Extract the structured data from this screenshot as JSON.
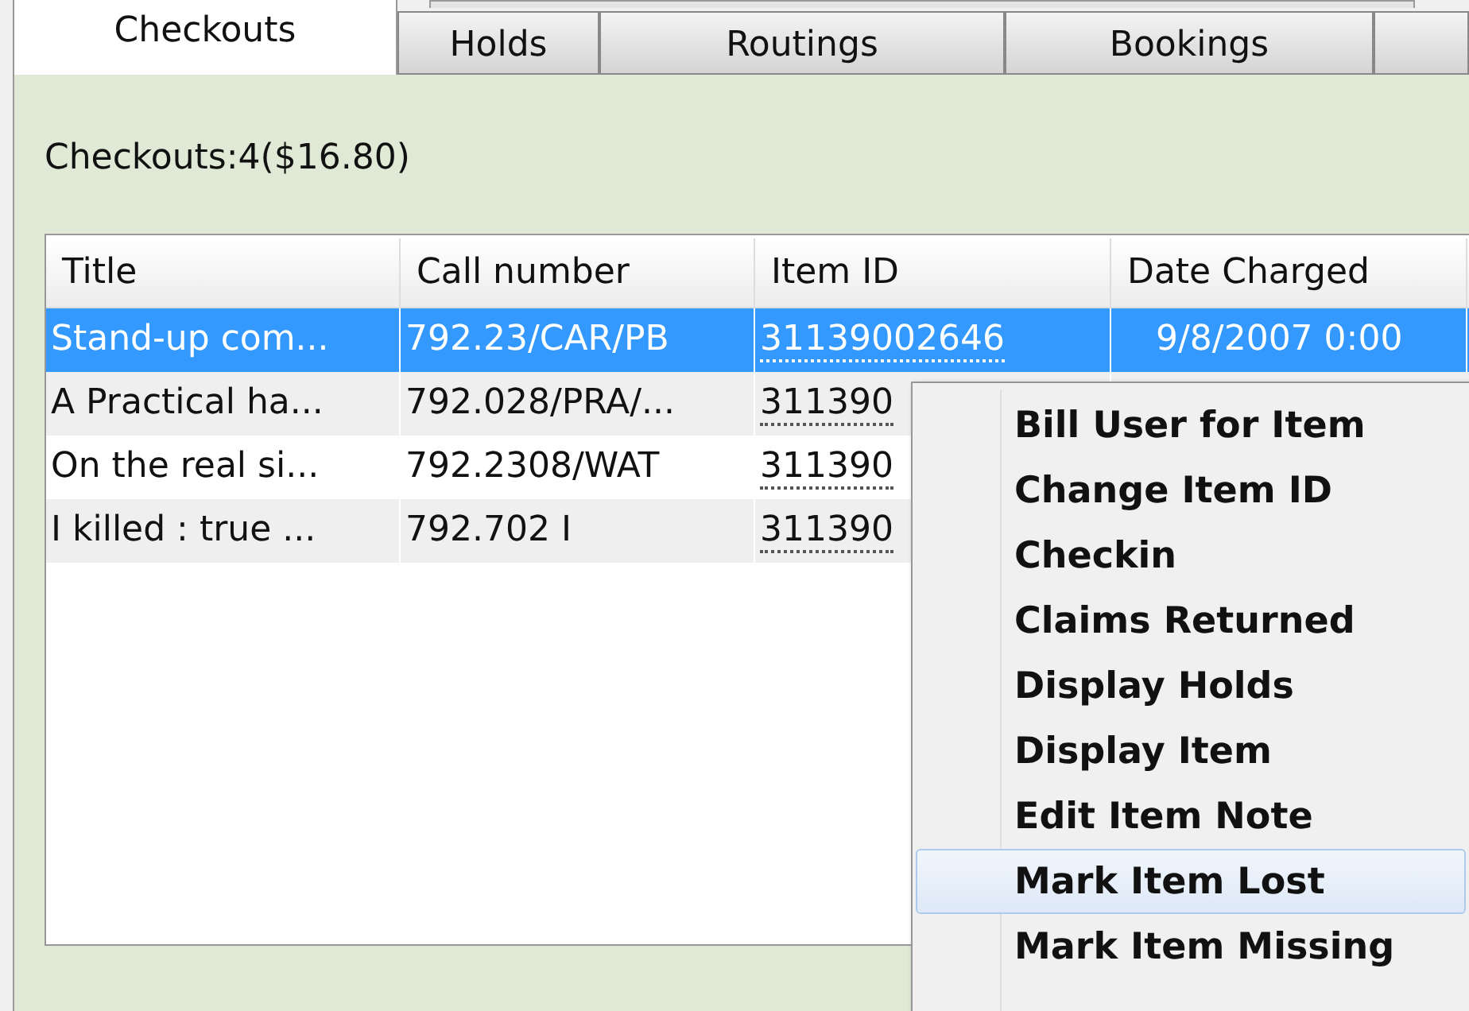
{
  "tabs": [
    {
      "label": "Checkouts",
      "selected": true
    },
    {
      "label": "Holds",
      "selected": false
    },
    {
      "label": "Routings",
      "selected": false
    },
    {
      "label": "Bookings",
      "selected": false
    }
  ],
  "summary": "Checkouts:4($16.80)",
  "table": {
    "columns": [
      "Title",
      "Call number",
      "Item ID",
      "Date Charged"
    ],
    "rows": [
      {
        "selected": true,
        "cells": [
          "Stand-up com...",
          "792.23/CAR/PB",
          "31139002646",
          "9/8/2007 0:00"
        ]
      },
      {
        "selected": false,
        "cells": [
          "A Practical ha...",
          "792.028/PRA/...",
          "311390"
        ]
      },
      {
        "selected": false,
        "cells": [
          "On the real si...",
          "792.2308/WAT",
          "311390"
        ]
      },
      {
        "selected": false,
        "cells": [
          "I killed : true ...",
          "792.702 I",
          "311390"
        ]
      }
    ]
  },
  "context_menu": {
    "items": [
      {
        "label": "Bill User for Item",
        "selected": false
      },
      {
        "label": "Change Item ID",
        "selected": false
      },
      {
        "label": "Checkin",
        "selected": false
      },
      {
        "label": "Claims Returned",
        "selected": false
      },
      {
        "label": "Display Holds",
        "selected": false
      },
      {
        "label": "Display Item",
        "selected": false
      },
      {
        "label": "Edit Item Note",
        "selected": false
      },
      {
        "label": "Mark Item Lost",
        "selected": true
      },
      {
        "label": "Mark Item Missing",
        "selected": false
      }
    ]
  }
}
